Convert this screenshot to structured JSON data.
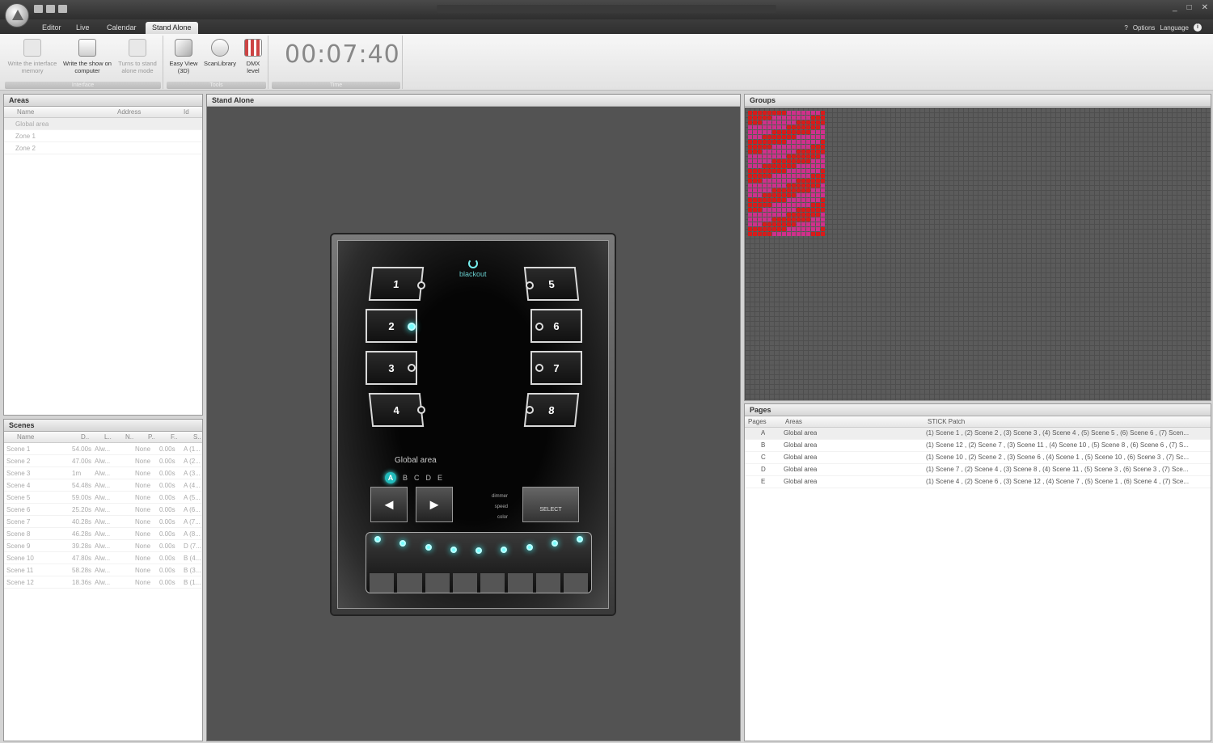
{
  "window": {
    "controls": [
      "_",
      "□",
      "✕"
    ]
  },
  "tabs": {
    "items": [
      "Editor",
      "Live",
      "Calendar",
      "Stand Alone"
    ],
    "active": "Stand Alone",
    "right": {
      "help": "?",
      "options": "Options",
      "language": "Language"
    }
  },
  "ribbon": {
    "groups": {
      "interface": "Interface",
      "tools": "Tools",
      "time": "Time"
    },
    "buttons": {
      "write_memory": "Write the interface memory",
      "write_show": "Write the show on computer",
      "turns_standalone": "Turns to stand alone mode",
      "easy_view": "Easy View (3D)",
      "scanlibrary": "ScanLibrary",
      "dmx_level": "DMX level"
    },
    "time": "00:07:40"
  },
  "areas": {
    "title": "Areas",
    "columns": {
      "name": "Name",
      "address": "Address",
      "id": "Id"
    },
    "rows": [
      "Global area",
      "Zone 1",
      "Zone 2"
    ]
  },
  "scenes": {
    "title": "Scenes",
    "columns": {
      "name": "Name",
      "d": "D..",
      "l": "L..",
      "n": "N..",
      "p": "P..",
      "f": "F..",
      "s": "S.."
    },
    "rows": [
      {
        "name": "Scene 1",
        "d": "54.00s",
        "l": "Alw...",
        "n": "None",
        "f": "0.00s",
        "s": "A (1..."
      },
      {
        "name": "Scene 2",
        "d": "47.00s",
        "l": "Alw...",
        "n": "None",
        "f": "0.00s",
        "s": "A (2..."
      },
      {
        "name": "Scene 3",
        "d": "1m",
        "l": "Alw...",
        "n": "None",
        "f": "0.00s",
        "s": "A (3..."
      },
      {
        "name": "Scene 4",
        "d": "54.48s",
        "l": "Alw...",
        "n": "None",
        "f": "0.00s",
        "s": "A (4..."
      },
      {
        "name": "Scene 5",
        "d": "59.00s",
        "l": "Alw...",
        "n": "None",
        "f": "0.00s",
        "s": "A (5..."
      },
      {
        "name": "Scene 6",
        "d": "25.20s",
        "l": "Alw...",
        "n": "None",
        "f": "0.00s",
        "s": "A (6..."
      },
      {
        "name": "Scene 7",
        "d": "40.28s",
        "l": "Alw...",
        "n": "None",
        "f": "0.00s",
        "s": "A (7..."
      },
      {
        "name": "Scene 8",
        "d": "46.28s",
        "l": "Alw...",
        "n": "None",
        "f": "0.00s",
        "s": "A (8..."
      },
      {
        "name": "Scene 9",
        "d": "39.28s",
        "l": "Alw...",
        "n": "None",
        "f": "0.00s",
        "s": "D (7..."
      },
      {
        "name": "Scene 10",
        "d": "47.80s",
        "l": "Alw...",
        "n": "None",
        "f": "0.00s",
        "s": "B (4..."
      },
      {
        "name": "Scene 11",
        "d": "58.28s",
        "l": "Alw...",
        "n": "None",
        "f": "0.00s",
        "s": "B (3..."
      },
      {
        "name": "Scene 12",
        "d": "18.36s",
        "l": "Alw...",
        "n": "None",
        "f": "0.00s",
        "s": "B (1..."
      }
    ]
  },
  "standalone": {
    "title": "Stand Alone",
    "blackout": "blackout",
    "zones": [
      "1",
      "2",
      "3",
      "4",
      "5",
      "6",
      "7",
      "8"
    ],
    "area": "Global area",
    "pages": [
      "A",
      "B",
      "C",
      "D",
      "E"
    ],
    "prev": "◄",
    "next": "►",
    "select_label": "SELECT",
    "mini_labels": [
      "dimmer",
      "speed",
      "color"
    ]
  },
  "groups": {
    "title": "Groups"
  },
  "pages_panel": {
    "title": "Pages",
    "columns": {
      "pages": "Pages",
      "areas": "Areas",
      "patch": "STICK Patch"
    },
    "rows": [
      {
        "page": "A",
        "area": "Global area",
        "patch": "(1) Scene 1 , (2) Scene 2 , (3) Scene 3 , (4) Scene 4 , (5) Scene 5 , (6) Scene 6 , (7) Scen..."
      },
      {
        "page": "B",
        "area": "Global area",
        "patch": "(1) Scene 12 , (2) Scene 7 , (3) Scene 11 , (4) Scene 10 , (5) Scene 8 , (6) Scene 6 , (7) S..."
      },
      {
        "page": "C",
        "area": "Global area",
        "patch": "(1) Scene 10 , (2) Scene 2 , (3) Scene 6 , (4) Scene 1 , (5) Scene 10 , (6) Scene 3 , (7) Sc..."
      },
      {
        "page": "D",
        "area": "Global area",
        "patch": "(1) Scene 7 , (2) Scene 4 , (3) Scene 8 , (4) Scene 11 , (5) Scene 3 , (6) Scene 3 , (7) Sce..."
      },
      {
        "page": "E",
        "area": "Global area",
        "patch": "(1) Scene 4 , (2) Scene 6 , (3) Scene 12 , (4) Scene 7 , (5) Scene 1 , (6) Scene 4 , (7) Sce..."
      }
    ]
  },
  "colors": {
    "accent": "#2bb",
    "grid_pink": "#d0308a",
    "grid_red": "#d81a1a"
  }
}
